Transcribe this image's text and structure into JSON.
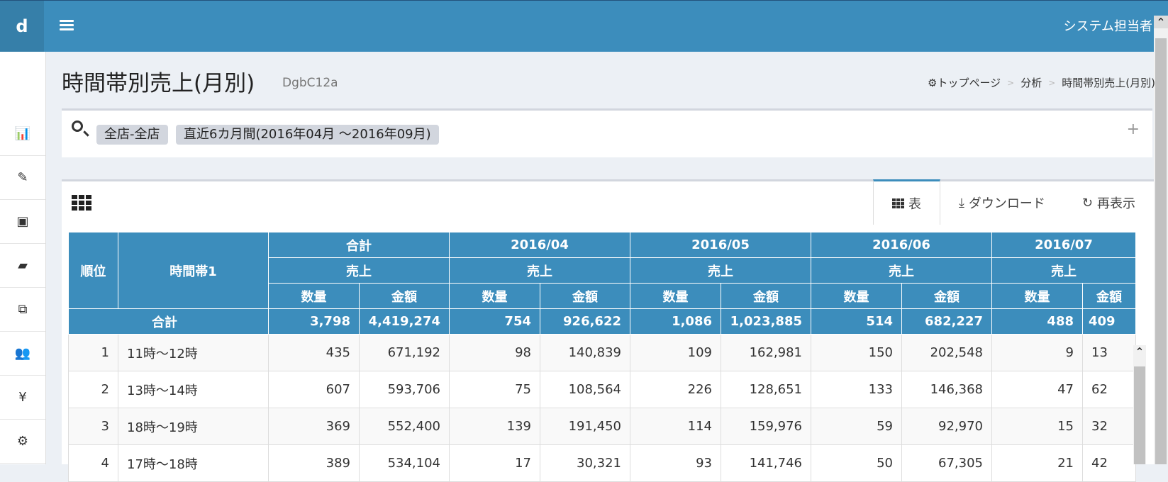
{
  "header": {
    "logo": "d",
    "user": "システム担当者"
  },
  "page": {
    "title": "時間帯別売上(月別)",
    "subtitle": "DgbC12a"
  },
  "breadcrumb": {
    "home": "トップページ",
    "section": "分析",
    "current": "時間帯別売上(月別)"
  },
  "filter": {
    "tags": [
      "全店-全店",
      "直近6カ月間(2016年04月 ～2016年09月)"
    ],
    "expand": "+"
  },
  "tabs": {
    "table": "表",
    "download": "ダウンロード",
    "refresh": "再表示"
  },
  "table": {
    "rank_header": "順位",
    "time_header": "時間帯1",
    "groups": [
      "合計",
      "2016/04",
      "2016/05",
      "2016/06",
      "2016/07"
    ],
    "sub_header": "売上",
    "qty_header": "数量",
    "amt_header": "金額",
    "total": {
      "label": "合計",
      "values": [
        "3,798",
        "4,419,274",
        "754",
        "926,622",
        "1,086",
        "1,023,885",
        "514",
        "682,227",
        "488",
        "409"
      ]
    },
    "rows": [
      {
        "rank": "1",
        "time": "11時～12時",
        "values": [
          "435",
          "671,192",
          "98",
          "140,839",
          "109",
          "162,981",
          "150",
          "202,548",
          "9",
          "13"
        ]
      },
      {
        "rank": "2",
        "time": "13時～14時",
        "values": [
          "607",
          "593,706",
          "75",
          "108,564",
          "226",
          "128,651",
          "133",
          "146,368",
          "47",
          "62"
        ]
      },
      {
        "rank": "3",
        "time": "18時～19時",
        "values": [
          "369",
          "552,400",
          "139",
          "191,450",
          "114",
          "159,976",
          "59",
          "92,970",
          "15",
          "32"
        ]
      },
      {
        "rank": "4",
        "time": "17時～18時",
        "values": [
          "389",
          "534,104",
          "17",
          "30,321",
          "93",
          "141,746",
          "50",
          "67,305",
          "21",
          "42"
        ]
      }
    ]
  }
}
